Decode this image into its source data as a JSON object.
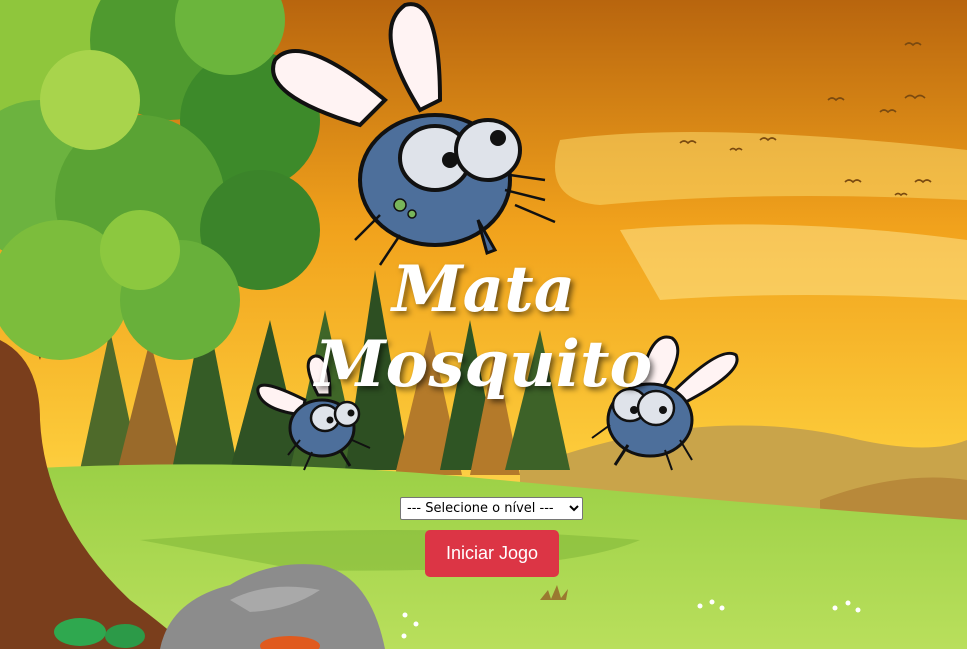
{
  "game": {
    "title_line_1": "Mata",
    "title_line_2": "Mosquito"
  },
  "level_select": {
    "selected": "--- Selecione o nível ---"
  },
  "start_button": {
    "label": "Iniciar Jogo",
    "color": "#dc3545"
  },
  "scene": {
    "sky_top": "#c97f10",
    "sky_bottom": "#fbd23d",
    "grass": "#8cc63f",
    "tree_foliage": "#6cb33f",
    "mosquito_body": "#4d6f9b"
  }
}
